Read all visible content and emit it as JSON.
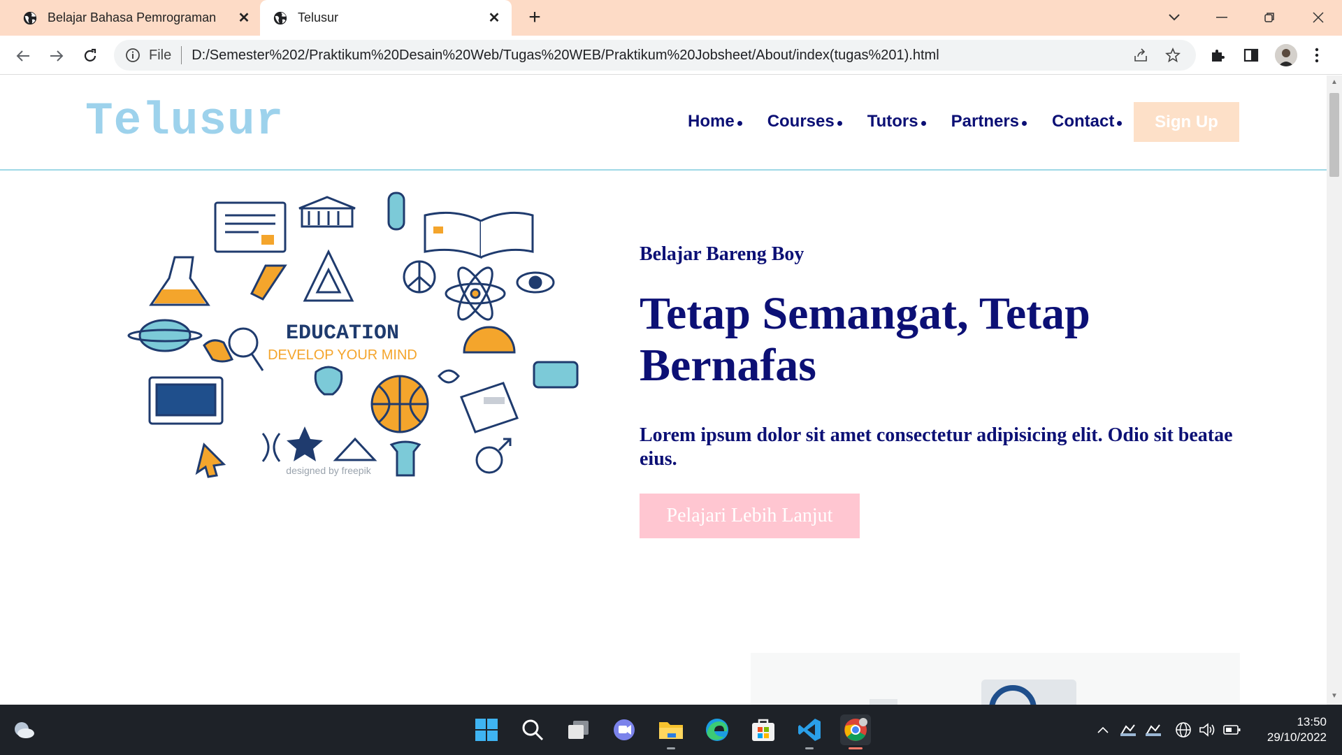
{
  "browser": {
    "tabs": [
      {
        "title": "Belajar Bahasa Pemrograman",
        "active": false
      },
      {
        "title": "Telusur",
        "active": true
      }
    ],
    "address": {
      "scheme_label": "File",
      "url": "D:/Semester%202/Praktikum%20Desain%20Web/Tugas%20WEB/Praktikum%20Jobsheet/About/index(tugas%201).html"
    },
    "tab_strip_color": "#fddbc6"
  },
  "site": {
    "logo": "Telusur",
    "nav": [
      {
        "label": "Home"
      },
      {
        "label": "Courses"
      },
      {
        "label": "Tutors"
      },
      {
        "label": "Partners"
      },
      {
        "label": "Contact"
      }
    ],
    "signup_label": "Sign Up",
    "hero": {
      "image_title": "EDUCATION",
      "image_subtitle": "DEVELOP YOUR MIND",
      "image_credit": "designed by freepik",
      "tagline": "Belajar Bareng Boy",
      "headline": "Tetap Semangat, Tetap Bernafas",
      "lead": "Lorem ipsum dolor sit amet consectetur adipisicing elit. Odio sit beatae eius.",
      "cta_label": "Pelajari Lebih Lanjut"
    },
    "colors": {
      "primary_text": "#0c1075",
      "logo": "#9dd2ec",
      "signup_bg": "#fde0c8",
      "cta_bg": "#ffc6d1",
      "header_border": "#9fd8e6"
    }
  },
  "taskbar": {
    "apps": [
      {
        "icon": "windows-start-icon"
      },
      {
        "icon": "search-icon"
      },
      {
        "icon": "task-view-icon"
      },
      {
        "icon": "teams-chat-icon"
      },
      {
        "icon": "file-explorer-icon"
      },
      {
        "icon": "edge-browser-icon"
      },
      {
        "icon": "microsoft-store-icon"
      },
      {
        "icon": "vscode-icon"
      },
      {
        "icon": "chrome-icon"
      }
    ],
    "time": "13:50",
    "date": "29/10/2022"
  }
}
